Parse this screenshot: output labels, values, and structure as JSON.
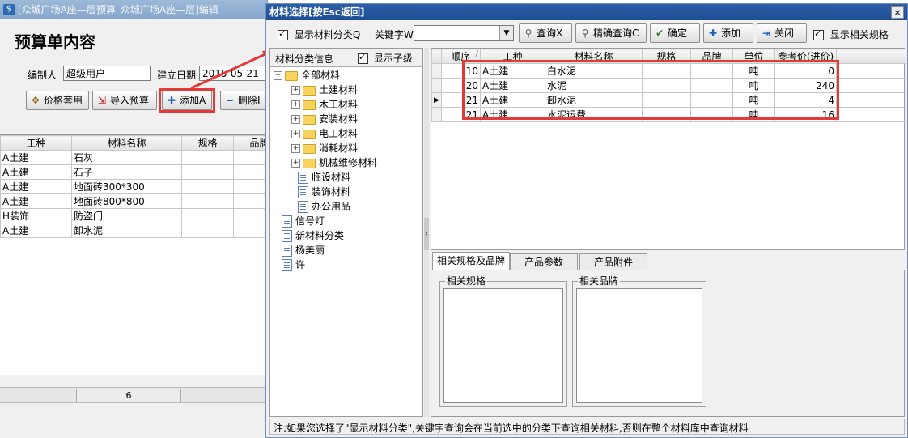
{
  "bg": {
    "title": "[众城广场A座—层预算_众城广场A座—层]编辑",
    "heading": "预算单内容",
    "editor_label": "编制人",
    "editor_value": "超级用户",
    "date_label": "建立日期",
    "date_value": "2015-05-21",
    "buttons": {
      "price": "价格套用",
      "import": "导入预算",
      "add": "添加A",
      "delete": "删除I"
    },
    "columns": [
      "工种",
      "材料名称",
      "规格",
      "品牌"
    ],
    "rows": [
      [
        "A土建",
        "石灰",
        "",
        ""
      ],
      [
        "A土建",
        "石子",
        "",
        ""
      ],
      [
        "A土建",
        "地面砖300*300",
        "",
        ""
      ],
      [
        "A土建",
        "地面砖800*800",
        "",
        ""
      ],
      [
        "H装饰",
        "防盗门",
        "",
        ""
      ],
      [
        "A土建",
        "卸水泥",
        "",
        ""
      ]
    ],
    "footer_count": "6"
  },
  "dlg": {
    "title": "材料选择[按Esc返回]",
    "close": "×",
    "toolbar": {
      "show_category": "显示材料分类Q",
      "keyword_label": "关键字W",
      "keyword_value": "",
      "query": "查询X",
      "exact_query": "精确查询C",
      "confirm": "确定",
      "add": "添加",
      "close": "关闭",
      "show_related": "显示相关规格"
    },
    "category": {
      "header": "材料分类信息",
      "show_children": "显示子级",
      "items": [
        {
          "label": "全部材料",
          "kind": "root"
        },
        {
          "label": "土建材料",
          "kind": "folder"
        },
        {
          "label": "木工材料",
          "kind": "folder"
        },
        {
          "label": "安装材料",
          "kind": "folder"
        },
        {
          "label": "电工材料",
          "kind": "folder"
        },
        {
          "label": "消耗材料",
          "kind": "folder"
        },
        {
          "label": "机械维修材料",
          "kind": "folder"
        },
        {
          "label": "临设材料",
          "kind": "doc"
        },
        {
          "label": "装饰材料",
          "kind": "doc"
        },
        {
          "label": "办公用品",
          "kind": "doc"
        },
        {
          "label": "信号灯",
          "kind": "doc"
        },
        {
          "label": "新材料分类",
          "kind": "doc"
        },
        {
          "label": "杨美丽",
          "kind": "doc"
        },
        {
          "label": "许",
          "kind": "doc"
        }
      ]
    },
    "results": {
      "columns": [
        "顺序",
        "工种",
        "材料名称",
        "规格",
        "品牌",
        "单位",
        "参考价(进价)"
      ],
      "sort_marker": "/",
      "rows": [
        [
          "10",
          "A土建",
          "白水泥",
          "",
          "",
          "吨",
          "0"
        ],
        [
          "20",
          "A土建",
          "水泥",
          "",
          "",
          "吨",
          "240"
        ],
        [
          "21",
          "A土建",
          "卸水泥",
          "",
          "",
          "吨",
          "4"
        ],
        [
          "21",
          "A土建",
          "水泥运费",
          "",
          "",
          "吨",
          "16"
        ]
      ],
      "current_row_marker": "▶"
    },
    "tabs": [
      "相关规格及品牌",
      "产品参数",
      "产品附件"
    ],
    "spec_group": "相关规格",
    "brand_group": "相关品牌",
    "footer_note": "注:如果您选择了\"显示材料分类\",关键字查询会在当前选中的分类下查询相关材料,否则在整个材料库中查询材料"
  },
  "colors": {
    "highlight": "#e53935",
    "title_bar": "#1e4d93",
    "folder": "#f7d35b"
  }
}
